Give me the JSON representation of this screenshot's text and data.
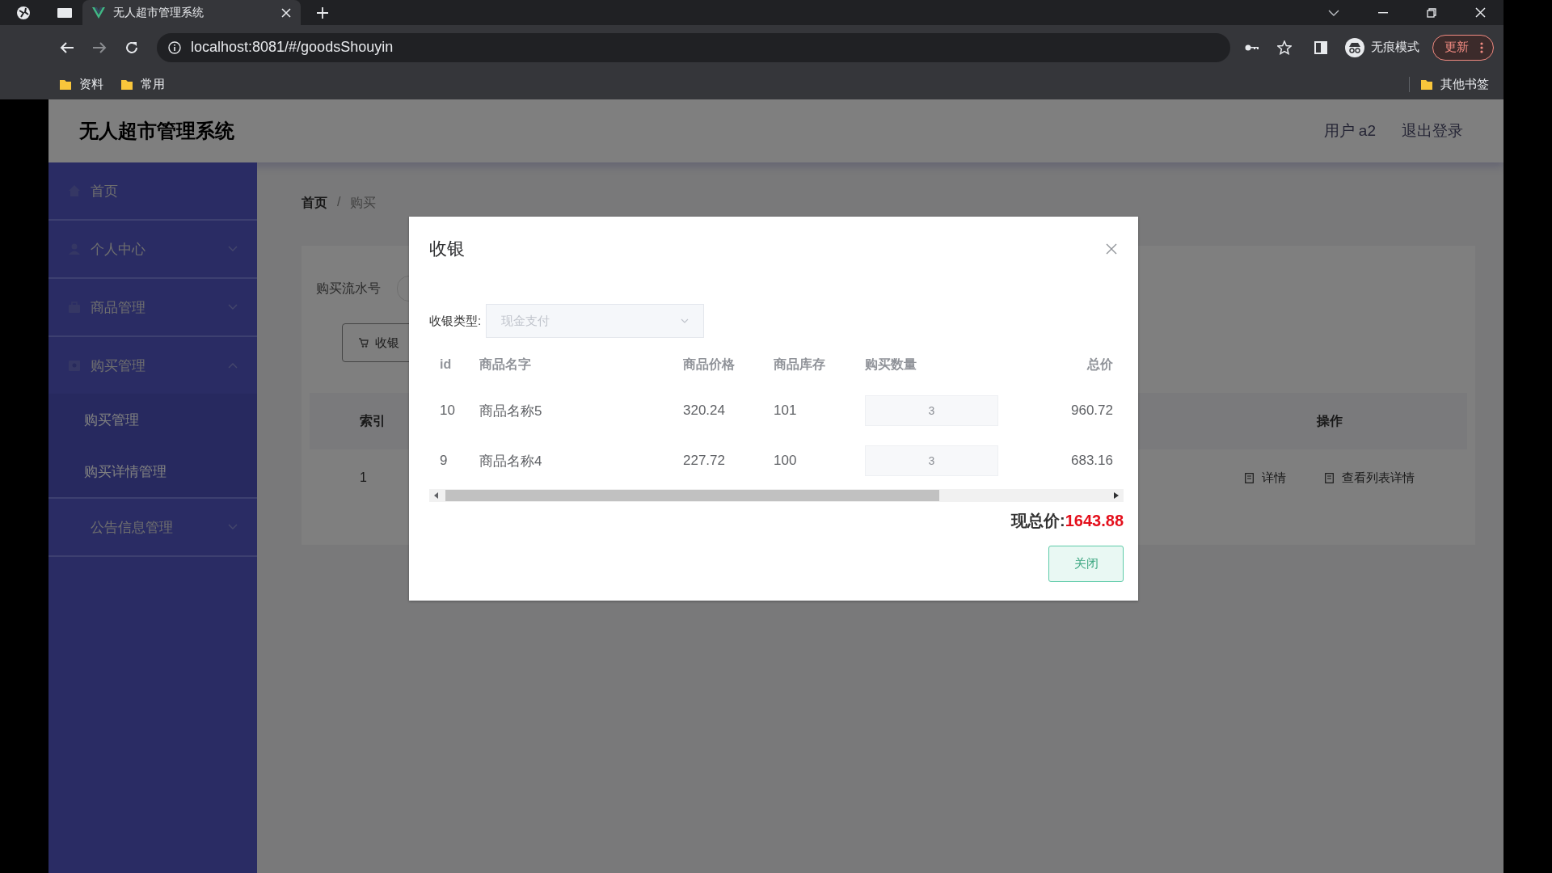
{
  "browser": {
    "tabs": [
      {
        "title": "无人超市管理系统",
        "selected": true
      }
    ],
    "url": "localhost:8081/#/goodsShouyin",
    "profile_label": "无痕模式",
    "update_button": "更新",
    "bookmarks": [
      "资料",
      "常用"
    ],
    "other_bookmarks": "其他书签"
  },
  "header": {
    "title": "无人超市管理系统",
    "user": "用户 a2",
    "logout": "退出登录"
  },
  "sidebar": {
    "items": [
      {
        "label": "首页",
        "kind": "link"
      },
      {
        "label": "个人中心",
        "kind": "submenu",
        "expanded": false
      },
      {
        "label": "商品管理",
        "kind": "submenu",
        "expanded": false
      },
      {
        "label": "购买管理",
        "kind": "submenu",
        "expanded": true,
        "children": [
          "购买管理",
          "购买详情管理"
        ]
      },
      {
        "label": "公告信息管理",
        "kind": "submenu",
        "expanded": false
      }
    ]
  },
  "content": {
    "breadcrumb": [
      "首页",
      "购买"
    ],
    "breadcrumb_separator": "/",
    "search_label": "购买流水号",
    "action_button": "收银",
    "table": {
      "columns": [
        "索引",
        "操作"
      ],
      "rows": [
        {
          "index": "1",
          "actions": [
            "详情",
            "查看列表详情"
          ]
        }
      ]
    }
  },
  "dialog": {
    "title": "收银",
    "field_label": "收银类型:",
    "select": {
      "value": "现金支付",
      "disabled": true
    },
    "columns": [
      "id",
      "商品名字",
      "商品价格",
      "商品库存",
      "购买数量",
      "总价"
    ],
    "rows": [
      {
        "id": "10",
        "name": "商品名称5",
        "price": "320.24",
        "stock": "101",
        "quantity": "3",
        "total": "960.72"
      },
      {
        "id": "9",
        "name": "商品名称4",
        "price": "227.72",
        "stock": "100",
        "quantity": "3",
        "total": "683.16"
      }
    ],
    "total_label": "现总价:",
    "total_value": "1643.88",
    "close_button": "关闭"
  }
}
